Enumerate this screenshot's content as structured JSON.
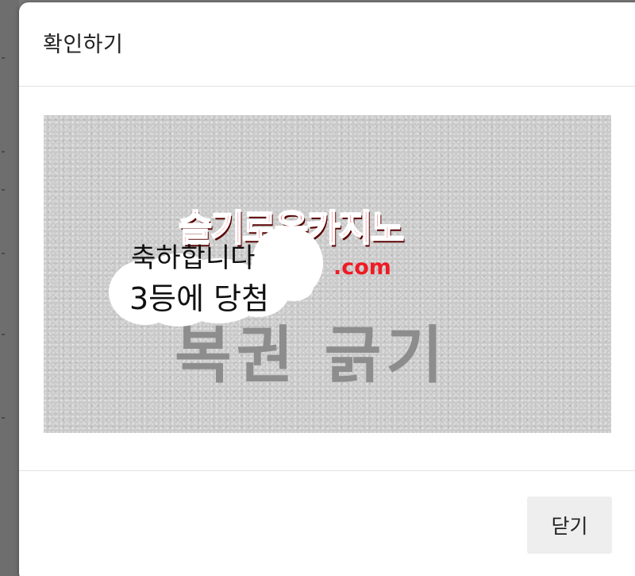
{
  "dialog": {
    "title": "확인하기",
    "close_label": "닫기"
  },
  "scratch_card": {
    "brand": "슬기로운카지노",
    "brand_domain": ".com",
    "cover_text": "복권 긁기",
    "revealed_line1": "축하합니다",
    "revealed_line2": "3등에 당첨",
    "brand_color": "#ee1c25"
  }
}
